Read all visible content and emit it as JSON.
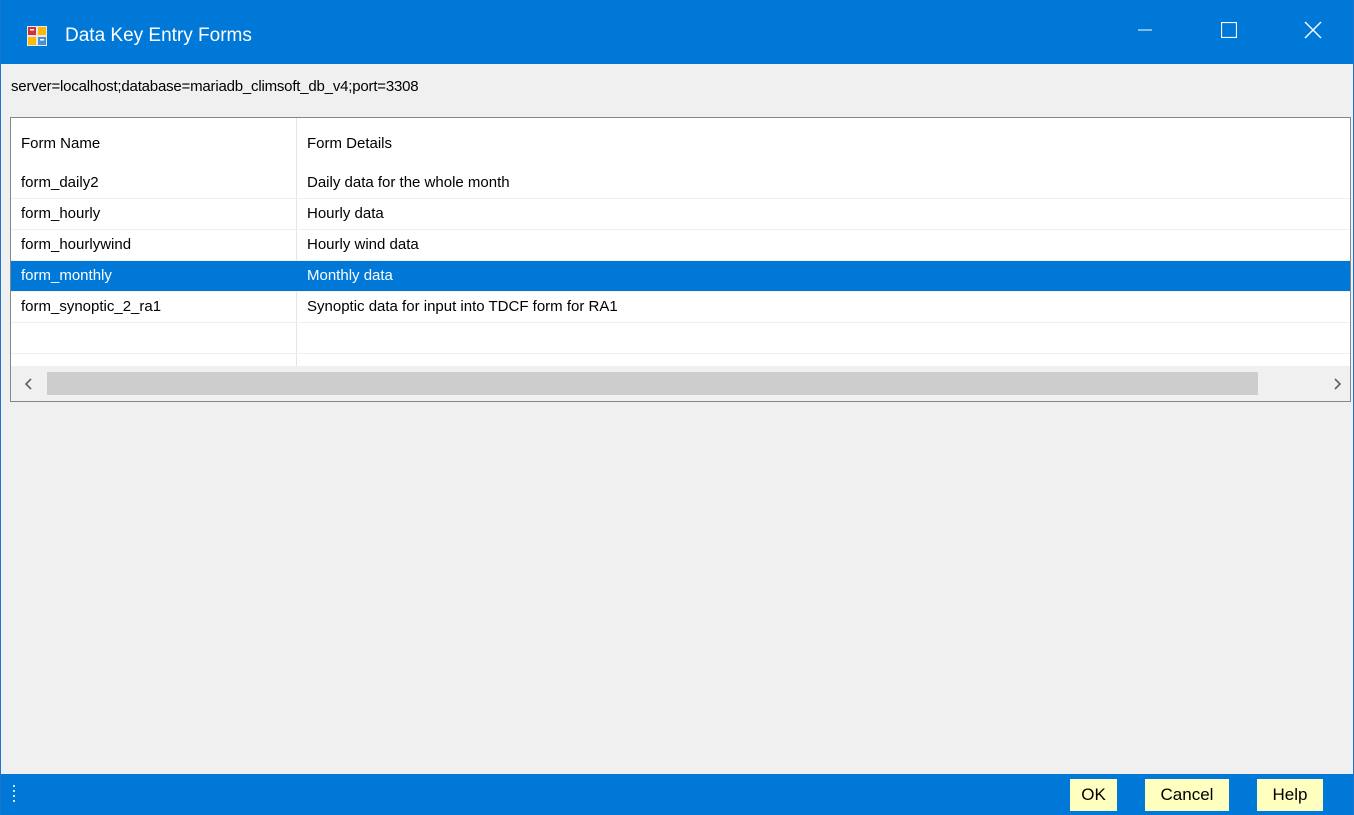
{
  "window": {
    "title": "Data Key Entry Forms",
    "controls": [
      "minimize-icon",
      "maximize-icon",
      "close-icon"
    ]
  },
  "connection_string": "server=localhost;database=mariadb_climsoft_db_v4;port=3308",
  "list": {
    "columns": [
      "Form Name",
      "Form Details"
    ],
    "rows": [
      {
        "name": "form_daily2",
        "details": "Daily data for the whole month",
        "selected": false
      },
      {
        "name": "form_hourly",
        "details": "Hourly data",
        "selected": false
      },
      {
        "name": "form_hourlywind",
        "details": "Hourly wind data",
        "selected": false
      },
      {
        "name": "form_monthly",
        "details": "Monthly data",
        "selected": true
      },
      {
        "name": "form_synoptic_2_ra1",
        "details": "Synoptic data for input into TDCF form for RA1",
        "selected": false
      }
    ]
  },
  "buttons": {
    "ok": "OK",
    "cancel": "Cancel",
    "help": "Help"
  },
  "colors": {
    "accent": "#0078d7",
    "button_bg": "#ffffc0",
    "selection": "#0078d7"
  }
}
